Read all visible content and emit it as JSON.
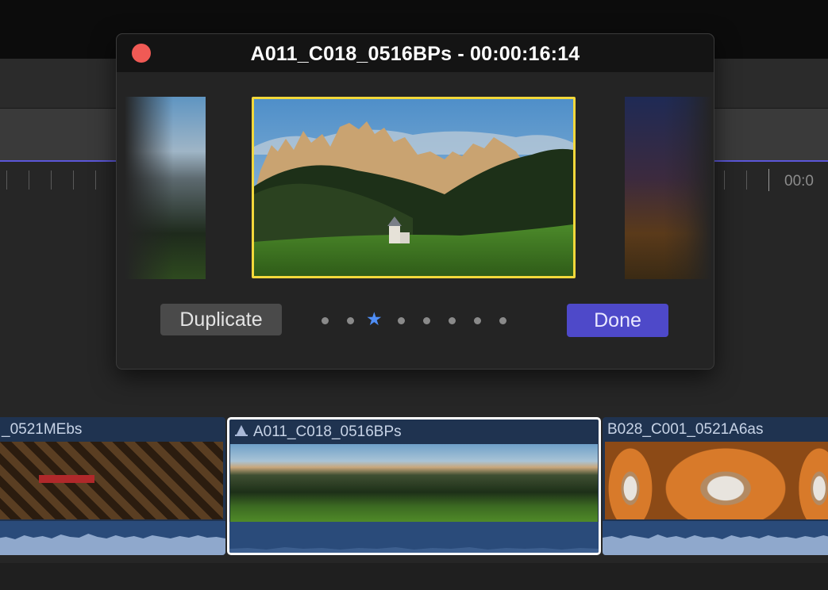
{
  "dialog": {
    "title": "A011_C018_0516BPs - 00:00:16:14",
    "duplicate_label": "Duplicate",
    "done_label": "Done",
    "page_count": 8,
    "current_page": 3
  },
  "ruler": {
    "timecode": "00:0"
  },
  "clips": [
    {
      "title": "_0521MEbs"
    },
    {
      "title": "A011_C018_0516BPs",
      "selected": true
    },
    {
      "title": "B028_C001_0521A6as"
    }
  ],
  "colors": {
    "accent": "#4e49c9",
    "selection": "#f2d83b",
    "close": "#f05a55",
    "active_dot": "#4f8ef7"
  },
  "icons": [
    "close-icon",
    "star-icon",
    "audition-icon"
  ]
}
